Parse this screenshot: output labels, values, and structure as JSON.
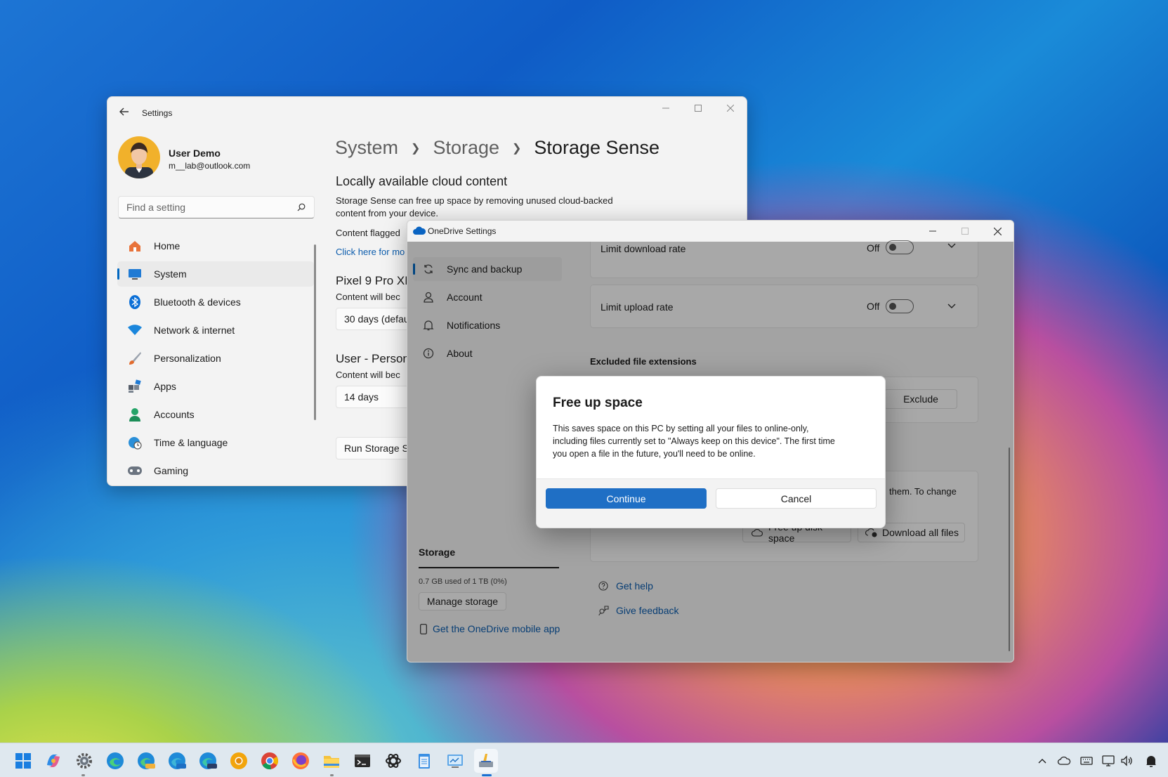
{
  "settings": {
    "title": "Settings",
    "user": {
      "name": "User Demo",
      "email": "m__lab@outlook.com"
    },
    "search": {
      "placeholder": "Find a setting"
    },
    "nav": [
      {
        "label": "Home",
        "icon": "home-icon"
      },
      {
        "label": "System",
        "icon": "system-icon",
        "selected": true
      },
      {
        "label": "Bluetooth & devices",
        "icon": "bluetooth-icon"
      },
      {
        "label": "Network & internet",
        "icon": "wifi-icon"
      },
      {
        "label": "Personalization",
        "icon": "brush-icon"
      },
      {
        "label": "Apps",
        "icon": "apps-icon"
      },
      {
        "label": "Accounts",
        "icon": "person-icon"
      },
      {
        "label": "Time & language",
        "icon": "globe-clock-icon"
      },
      {
        "label": "Gaming",
        "icon": "gamepad-icon"
      }
    ],
    "breadcrumb": [
      "System",
      "Storage",
      "Storage Sense"
    ],
    "section_title": "Locally available cloud content",
    "section_desc_1": "Storage Sense can free up space by removing unused cloud-backed",
    "section_desc_2": "content from your device.",
    "content_flagged": "Content flagged",
    "click_link": "Click here for mo",
    "pixel_heading": "Pixel 9 Pro XL",
    "pixel_desc": "Content will bec",
    "pixel_select": "30 days (defau",
    "user_heading": "User - Person",
    "user_desc": "Content will bec",
    "user_select": "14 days",
    "run_button": "Run Storage Se"
  },
  "onedrive": {
    "title": "OneDrive Settings",
    "nav": [
      {
        "label": "Sync and backup",
        "icon": "sync-icon",
        "selected": true
      },
      {
        "label": "Account",
        "icon": "person-icon"
      },
      {
        "label": "Notifications",
        "icon": "bell-icon"
      },
      {
        "label": "About",
        "icon": "info-icon"
      }
    ],
    "storage_heading": "Storage",
    "storage_used": "0.7 GB used of 1 TB (0%)",
    "manage_storage": "Manage storage",
    "mobile_app": "Get the OneDrive mobile app",
    "limit_download": "Limit download rate",
    "limit_upload": "Limit upload rate",
    "off_label": "Off",
    "excluded_heading": "Excluded file extensions",
    "exclude_button": "Exclude",
    "partial_text": "them. To change",
    "free_up_button": "Free up disk space",
    "download_all_button": "Download all files",
    "get_help": "Get help",
    "give_feedback": "Give feedback"
  },
  "dialog": {
    "title": "Free up space",
    "body_1": "This saves space on this PC by setting all your files to online-only,",
    "body_2": "including files currently set to \"Always keep on this device\". The first time",
    "body_3": "you open a file in the future, you'll need to be online.",
    "continue": "Continue",
    "cancel": "Cancel"
  },
  "taskbar": {
    "apps": [
      "start-icon",
      "copilot-icon",
      "settings-gear-icon",
      "edge-icon",
      "edge-canary-icon",
      "edge-beta-icon",
      "edge-dev-icon",
      "chrome-canary-icon",
      "chrome-icon",
      "firefox-icon",
      "file-explorer-icon",
      "terminal-icon",
      "chatgpt-icon",
      "notepad-icon",
      "control-panel-icon",
      "disk-cleanup-icon"
    ],
    "tray": [
      "chevron-up-icon",
      "onedrive-cloud-icon",
      "keyboard-icon",
      "network-icon",
      "volume-icon",
      "notification-icon"
    ]
  },
  "colors": {
    "accent": "#0067c0",
    "button_primary": "#1f6fc5",
    "link": "#0b5cad"
  }
}
